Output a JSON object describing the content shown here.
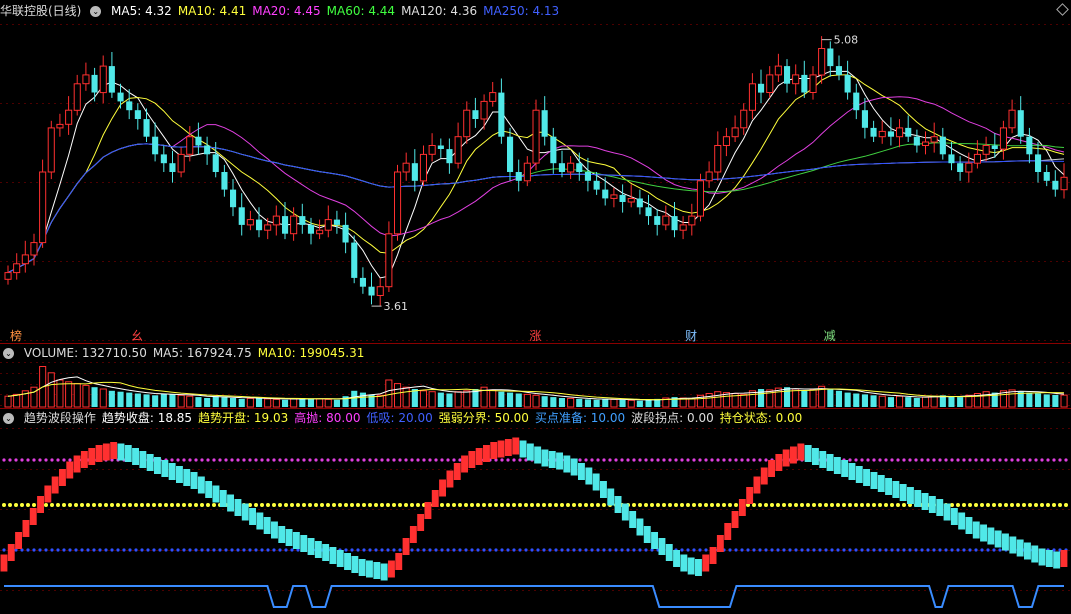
{
  "main_header": {
    "title": "华联控股(日线)",
    "ma": [
      {
        "label": "MA5: 4.32",
        "color": "#ffffff"
      },
      {
        "label": "MA10: 4.41",
        "color": "#ffff3c"
      },
      {
        "label": "MA20: 4.45",
        "color": "#ff40ff"
      },
      {
        "label": "MA60: 4.44",
        "color": "#40ff40"
      },
      {
        "label": "MA120: 4.36",
        "color": "#dddddd"
      },
      {
        "label": "MA250: 4.13",
        "color": "#4060ff"
      }
    ]
  },
  "vol_header": [
    {
      "label": "VOLUME: 132710.50",
      "color": "#dddddd"
    },
    {
      "label": "MA5: 167924.75",
      "color": "#dddddd"
    },
    {
      "label": "MA10: 199045.31",
      "color": "#ffff3c"
    }
  ],
  "ind_header": [
    {
      "label": "趋势波段操作",
      "color": "#dddddd"
    },
    {
      "label": "趋势收盘: 18.85",
      "color": "#ffffff"
    },
    {
      "label": "趋势开盘: 19.03",
      "color": "#ffff3c"
    },
    {
      "label": "高抛: 80.00",
      "color": "#ff40ff"
    },
    {
      "label": "低吸: 20.00",
      "color": "#4060ff"
    },
    {
      "label": "强弱分界: 50.00",
      "color": "#ffff3c"
    },
    {
      "label": "买点准备: 10.00",
      "color": "#40a0ff"
    },
    {
      "label": "波段拐点: 0.00",
      "color": "#dddddd"
    },
    {
      "label": "持仓状态: 0.00",
      "color": "#ffff3c"
    }
  ],
  "colors": {
    "up": "#ff3030",
    "down": "#50e8e8",
    "ma5": "#ffffff",
    "ma10": "#ffff3c",
    "ma20": "#e040e0",
    "ma60": "#40d040",
    "ma120": "#cfcfcf",
    "ma250": "#3050ff",
    "grid": "#8a0000",
    "hold": "#3a8cff"
  },
  "chart_data": [
    {
      "type": "candlestick",
      "panel": "price",
      "ylim": [
        3.5,
        5.2
      ],
      "count": 123,
      "high_marker": "5.08",
      "low_marker": "3.61",
      "bottom_labels": [
        {
          "index": 0,
          "text": "榜",
          "color": "#ff9040"
        },
        {
          "index": 14,
          "text": "幺",
          "color": "#ff4040"
        },
        {
          "index": 60,
          "text": "涨",
          "color": "#ff4040"
        },
        {
          "index": 78,
          "text": "财",
          "color": "#80c0ff"
        },
        {
          "index": 94,
          "text": "减",
          "color": "#80e080"
        }
      ],
      "closes": [
        3.78,
        3.83,
        3.88,
        3.95,
        4.35,
        4.6,
        4.62,
        4.7,
        4.85,
        4.9,
        4.8,
        4.95,
        4.8,
        4.75,
        4.7,
        4.65,
        4.55,
        4.45,
        4.4,
        4.35,
        4.45,
        4.55,
        4.5,
        4.45,
        4.35,
        4.25,
        4.15,
        4.05,
        4.08,
        4.02,
        4.05,
        4.1,
        4.0,
        4.1,
        4.05,
        4.0,
        4.02,
        4.08,
        4.05,
        3.95,
        3.75,
        3.7,
        3.65,
        3.7,
        4.0,
        4.35,
        4.4,
        4.3,
        4.45,
        4.5,
        4.48,
        4.4,
        4.55,
        4.7,
        4.65,
        4.75,
        4.8,
        4.55,
        4.35,
        4.3,
        4.4,
        4.7,
        4.55,
        4.4,
        4.35,
        4.4,
        4.35,
        4.3,
        4.25,
        4.2,
        4.22,
        4.18,
        4.2,
        4.15,
        4.1,
        4.05,
        4.1,
        4.02,
        4.05,
        4.1,
        4.3,
        4.35,
        4.5,
        4.55,
        4.6,
        4.7,
        4.85,
        4.8,
        4.9,
        4.95,
        4.85,
        4.9,
        4.8,
        4.9,
        5.05,
        4.95,
        4.9,
        4.8,
        4.7,
        4.6,
        4.55,
        4.58,
        4.55,
        4.6,
        4.55,
        4.5,
        4.52,
        4.55,
        4.45,
        4.4,
        4.35,
        4.4,
        4.45,
        4.5,
        4.48,
        4.6,
        4.7,
        4.55,
        4.45,
        4.35,
        4.3,
        4.25,
        4.32
      ],
      "series": [
        {
          "name": "MA5",
          "period": 5
        },
        {
          "name": "MA10",
          "period": 10
        },
        {
          "name": "MA20",
          "period": 20
        },
        {
          "name": "MA60",
          "period": 60
        },
        {
          "name": "MA120",
          "period": 120
        },
        {
          "name": "MA250",
          "period": 250
        }
      ]
    },
    {
      "type": "bar",
      "panel": "volume",
      "ylim": [
        0,
        500000
      ],
      "values": [
        120000,
        140000,
        180000,
        220000,
        450000,
        380000,
        300000,
        280000,
        260000,
        240000,
        220000,
        200000,
        180000,
        170000,
        160000,
        150000,
        140000,
        130000,
        150000,
        140000,
        130000,
        120000,
        110000,
        100000,
        120000,
        110000,
        100000,
        90000,
        95000,
        100000,
        90000,
        85000,
        80000,
        90000,
        100000,
        95000,
        90000,
        85000,
        80000,
        120000,
        180000,
        160000,
        140000,
        130000,
        300000,
        260000,
        220000,
        200000,
        180000,
        170000,
        160000,
        150000,
        170000,
        180000,
        200000,
        220000,
        190000,
        170000,
        160000,
        150000,
        140000,
        130000,
        120000,
        110000,
        100000,
        95000,
        90000,
        85000,
        80000,
        90000,
        85000,
        80000,
        75000,
        70000,
        80000,
        90000,
        100000,
        110000,
        100000,
        95000,
        130000,
        150000,
        170000,
        160000,
        150000,
        140000,
        180000,
        200000,
        190000,
        210000,
        220000,
        200000,
        180000,
        190000,
        230000,
        200000,
        180000,
        160000,
        150000,
        140000,
        130000,
        120000,
        110000,
        120000,
        110000,
        100000,
        110000,
        120000,
        130000,
        120000,
        110000,
        130000,
        150000,
        170000,
        160000,
        180000,
        190000,
        170000,
        160000,
        150000,
        140000,
        135000,
        132710
      ]
    },
    {
      "type": "bar",
      "panel": "indicator",
      "ylim": [
        0,
        100
      ],
      "levels": [
        {
          "name": "高抛",
          "value": 80
        },
        {
          "name": "强弱分界",
          "value": 50
        },
        {
          "name": "低吸",
          "value": 20
        }
      ],
      "values": [
        11,
        18,
        26,
        34,
        42,
        50,
        57,
        63,
        68,
        73,
        77,
        80,
        82,
        84,
        85,
        86,
        85,
        84,
        82,
        80,
        78,
        76,
        74,
        72,
        70,
        68,
        66,
        63,
        60,
        57,
        54,
        51,
        48,
        45,
        42,
        39,
        36,
        33,
        30,
        28,
        26,
        24,
        22,
        20,
        18,
        16,
        14,
        12,
        10,
        8,
        7,
        6,
        5,
        7,
        12,
        22,
        30,
        38,
        46,
        54,
        61,
        67,
        72,
        77,
        80,
        82,
        84,
        86,
        87,
        88,
        89,
        87,
        85,
        83,
        81,
        80,
        79,
        77,
        75,
        72,
        69,
        65,
        60,
        55,
        50,
        45,
        40,
        35,
        30,
        26,
        22,
        18,
        14,
        11,
        9,
        8,
        11,
        16,
        24,
        32,
        40,
        48,
        56,
        63,
        69,
        74,
        78,
        81,
        83,
        85,
        84,
        82,
        80,
        78,
        76,
        74,
        72,
        70,
        68,
        66,
        64,
        62,
        60,
        58,
        56,
        54,
        52,
        50,
        48,
        45,
        42,
        39,
        36,
        33,
        31,
        29,
        27,
        25,
        23,
        21,
        19,
        17,
        15,
        14,
        13,
        14
      ],
      "hold_state": [
        1,
        1,
        1,
        1,
        1,
        1,
        1,
        1,
        1,
        1,
        1,
        1,
        1,
        1,
        1,
        1,
        1,
        1,
        1,
        1,
        1,
        1,
        1,
        1,
        1,
        1,
        1,
        1,
        1,
        1,
        1,
        1,
        1,
        1,
        1,
        1,
        1,
        1,
        1,
        1,
        1,
        1,
        0,
        0,
        0,
        1,
        1,
        1,
        0,
        0,
        0,
        1,
        1,
        1,
        1,
        1,
        1,
        1,
        1,
        1,
        1,
        1,
        1,
        1,
        1,
        1,
        1,
        1,
        1,
        1,
        1,
        1,
        1,
        1,
        1,
        1,
        1,
        1,
        1,
        1,
        1,
        1,
        1,
        1,
        1,
        1,
        1,
        1,
        1,
        1,
        1,
        1,
        1,
        1,
        1,
        1,
        1,
        1,
        1,
        1,
        1,
        1,
        0,
        0,
        0,
        0,
        0,
        0,
        0,
        0,
        0,
        0,
        0,
        0,
        1,
        1,
        1,
        1,
        1,
        1,
        1,
        1,
        1,
        1,
        1,
        1,
        1,
        1,
        1,
        1,
        1,
        1,
        1,
        1,
        1,
        1,
        1,
        1,
        1,
        1,
        1,
        1,
        1,
        1,
        1,
        0,
        0,
        1,
        1,
        1,
        1,
        1,
        1,
        1,
        1,
        1,
        1,
        1,
        0,
        0,
        0,
        1,
        1,
        1,
        1,
        1
      ]
    }
  ]
}
